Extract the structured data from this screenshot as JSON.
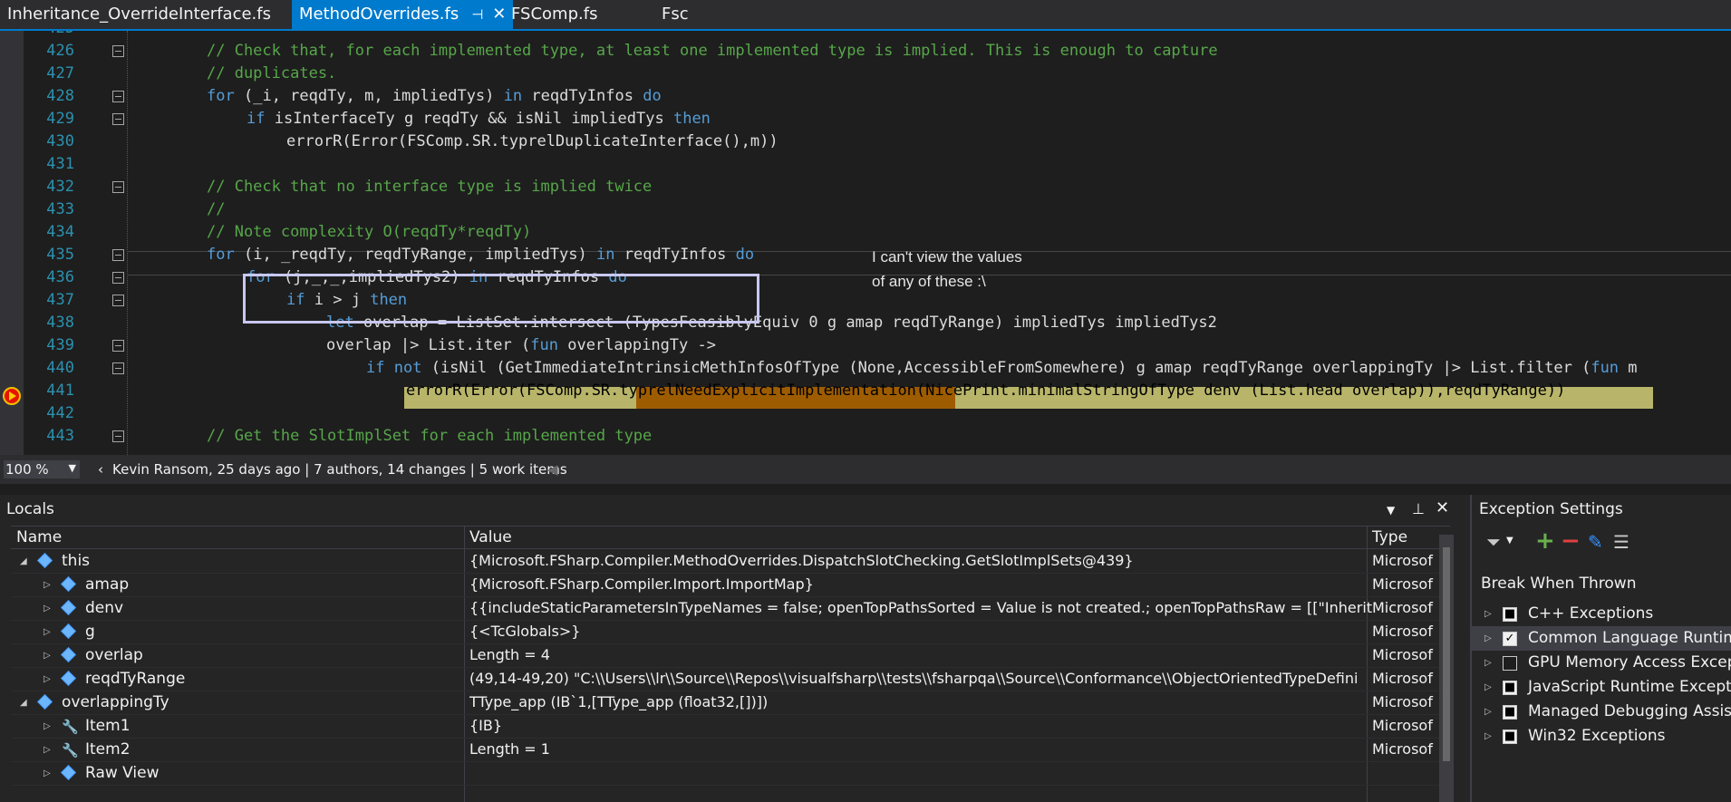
{
  "tabs": [
    {
      "label": "Inheritance_OverrideInterface.fs",
      "active": false
    },
    {
      "label": "MethodOverrides.fs",
      "active": true
    },
    {
      "label": "FSComp.fs",
      "active": false
    },
    {
      "label": "Fsc",
      "active": false
    }
  ],
  "editor": {
    "partial_line": "425",
    "lines": [
      {
        "n": "426",
        "text": "// Check that, for each implemented type, at least one implemented type is implied. This is enough to capture"
      },
      {
        "n": "427",
        "text": "// duplicates."
      },
      {
        "n": "428",
        "text": "for (_i, reqdTy, m, impliedTys) in reqdTyInfos do"
      },
      {
        "n": "429",
        "text": "if isInterfaceTy g reqdTy && isNil impliedTys then"
      },
      {
        "n": "430",
        "text": "errorR(Error(FSComp.SR.typrelDuplicateInterface(),m))"
      },
      {
        "n": "431",
        "text": ""
      },
      {
        "n": "432",
        "text": "// Check that no interface type is implied twice"
      },
      {
        "n": "433",
        "text": "//"
      },
      {
        "n": "434",
        "text": "// Note complexity O(reqdTy*reqdTy)"
      },
      {
        "n": "435",
        "text": "for (i, _reqdTy, reqdTyRange, impliedTys) in reqdTyInfos do"
      },
      {
        "n": "436",
        "text": "for (j,_,_,impliedTys2) in reqdTyInfos do"
      },
      {
        "n": "437",
        "text": "if i > j then"
      },
      {
        "n": "438",
        "text": "let overlap = ListSet.intersect (TypesFeasiblyEquiv 0 g amap reqdTyRange) impliedTys impliedTys2"
      },
      {
        "n": "439",
        "text": "overlap |> List.iter (fun overlappingTy ->"
      },
      {
        "n": "440",
        "text": "if not (isNil (GetImmediateIntrinsicMethInfosOfType (None,AccessibleFromSomewhere) g amap reqdTyRange overlappingTy |> List.filter (fun m"
      },
      {
        "n": "441",
        "text": "errorR(Error(FSComp.SR.typrelNeedExplicitImplementation(NicePrint.minimalStringOfType denv (List.head overlap)),reqdTyRange))"
      },
      {
        "n": "442",
        "text": ""
      },
      {
        "n": "443",
        "text": "// Get the SlotImplSet for each implemented type"
      }
    ],
    "annotation_line1": "I can't view the values",
    "annotation_line2": "of any of these :\\"
  },
  "status": {
    "zoom": "100 %",
    "author_info": "Kevin Ransom, 25 days ago | 7 authors, 14 changes | 5 work items"
  },
  "locals": {
    "title": "Locals",
    "columns": [
      "Name",
      "Value",
      "Type"
    ],
    "rows": [
      {
        "name": "this",
        "value": "{Microsoft.FSharp.Compiler.MethodOverrides.DispatchSlotChecking.GetSlotImplSets@439}",
        "type": "Microsof"
      },
      {
        "name": "amap",
        "value": "{Microsoft.FSharp.Compiler.Import.ImportMap}",
        "type": "Microsof"
      },
      {
        "name": "denv",
        "value": "{{includeStaticParametersInTypeNames = false; openTopPathsSorted = Value is not created.; openTopPathsRaw =  [[\"Inheritance",
        "type": "Microsof"
      },
      {
        "name": "g",
        "value": "{<TcGlobals>}",
        "type": "Microsof"
      },
      {
        "name": "overlap",
        "value": "Length = 4",
        "type": "Microsof"
      },
      {
        "name": "reqdTyRange",
        "value": "(49,14-49,20) \"C:\\\\Users\\\\lr\\\\Source\\\\Repos\\\\visualfsharp\\\\tests\\\\fsharpqa\\\\Source\\\\Conformance\\\\ObjectOrientedTypeDefini",
        "type": "Microsof"
      },
      {
        "name": "overlappingTy",
        "value": "TType_app (IB`1,[TType_app (float32,[])])",
        "type": "Microsof"
      },
      {
        "name": "Item1",
        "value": "{IB}",
        "type": "Microsof"
      },
      {
        "name": "Item2",
        "value": "Length = 1",
        "type": "Microsof"
      },
      {
        "name": "Raw View",
        "value": "",
        "type": ""
      }
    ]
  },
  "exceptions": {
    "title": "Exception Settings",
    "break_label": "Break When Thrown",
    "items": [
      {
        "label": "C++ Exceptions",
        "checked": "filled"
      },
      {
        "label": "Common Language Runtime",
        "checked": "check"
      },
      {
        "label": "GPU Memory Access Excepti",
        "checked": "empty"
      },
      {
        "label": "JavaScript Runtime Exception",
        "checked": "filled"
      },
      {
        "label": "Managed Debugging Assista",
        "checked": "filled"
      },
      {
        "label": "Win32 Exceptions",
        "checked": "filled"
      }
    ]
  }
}
